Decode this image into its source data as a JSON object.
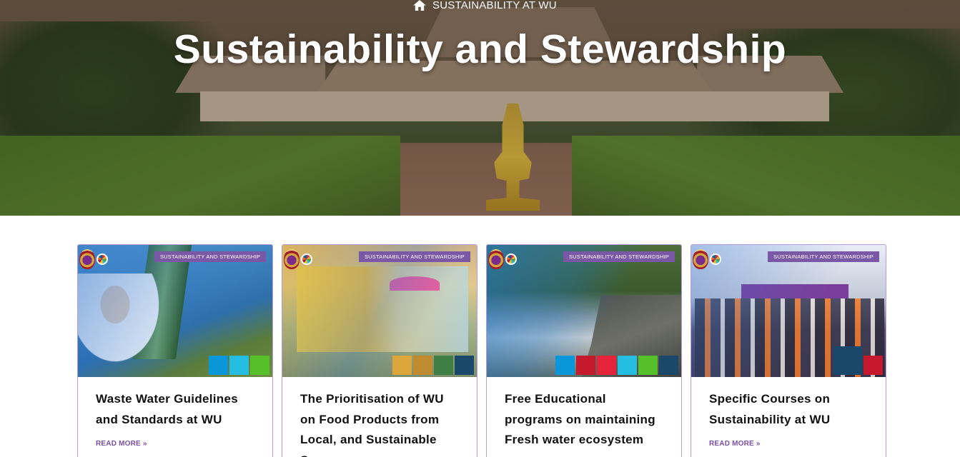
{
  "hero": {
    "breadcrumb": "SUSTAINABILITY AT WU",
    "title": "Sustainability and Stewardship"
  },
  "cards": [
    {
      "category": "SUSTAINABILITY AND STEWARDSHIP",
      "title": "Waste Water Guidelines and Standards at WU",
      "read_more": "READ MORE »",
      "sdg_colors": [
        "#0a97d9",
        "#26bde2",
        "#56c02b"
      ]
    },
    {
      "category": "SUSTAINABILITY AND STEWARDSHIP",
      "title": "The Prioritisation of WU on Food Products from Local, and Sustainable Sources",
      "read_more": "",
      "sdg_colors": [
        "#dda63a",
        "#bf8b2e",
        "#3f7e44",
        "#19486a"
      ]
    },
    {
      "category": "SUSTAINABILITY AND STEWARDSHIP",
      "title": "Free Educational programs on maintaining Fresh water ecosystem",
      "read_more": "",
      "sdg_colors": [
        "#0a97d9",
        "#c5192d",
        "#e5243b",
        "#26bde2",
        "#56c02b",
        "#19486a"
      ]
    },
    {
      "category": "SUSTAINABILITY AND STEWARDSHIP",
      "title": "Specific Courses on Sustainability at WU",
      "read_more": "READ MORE »",
      "sdg_colors": [
        "#19486a",
        "#c5192d"
      ]
    }
  ]
}
